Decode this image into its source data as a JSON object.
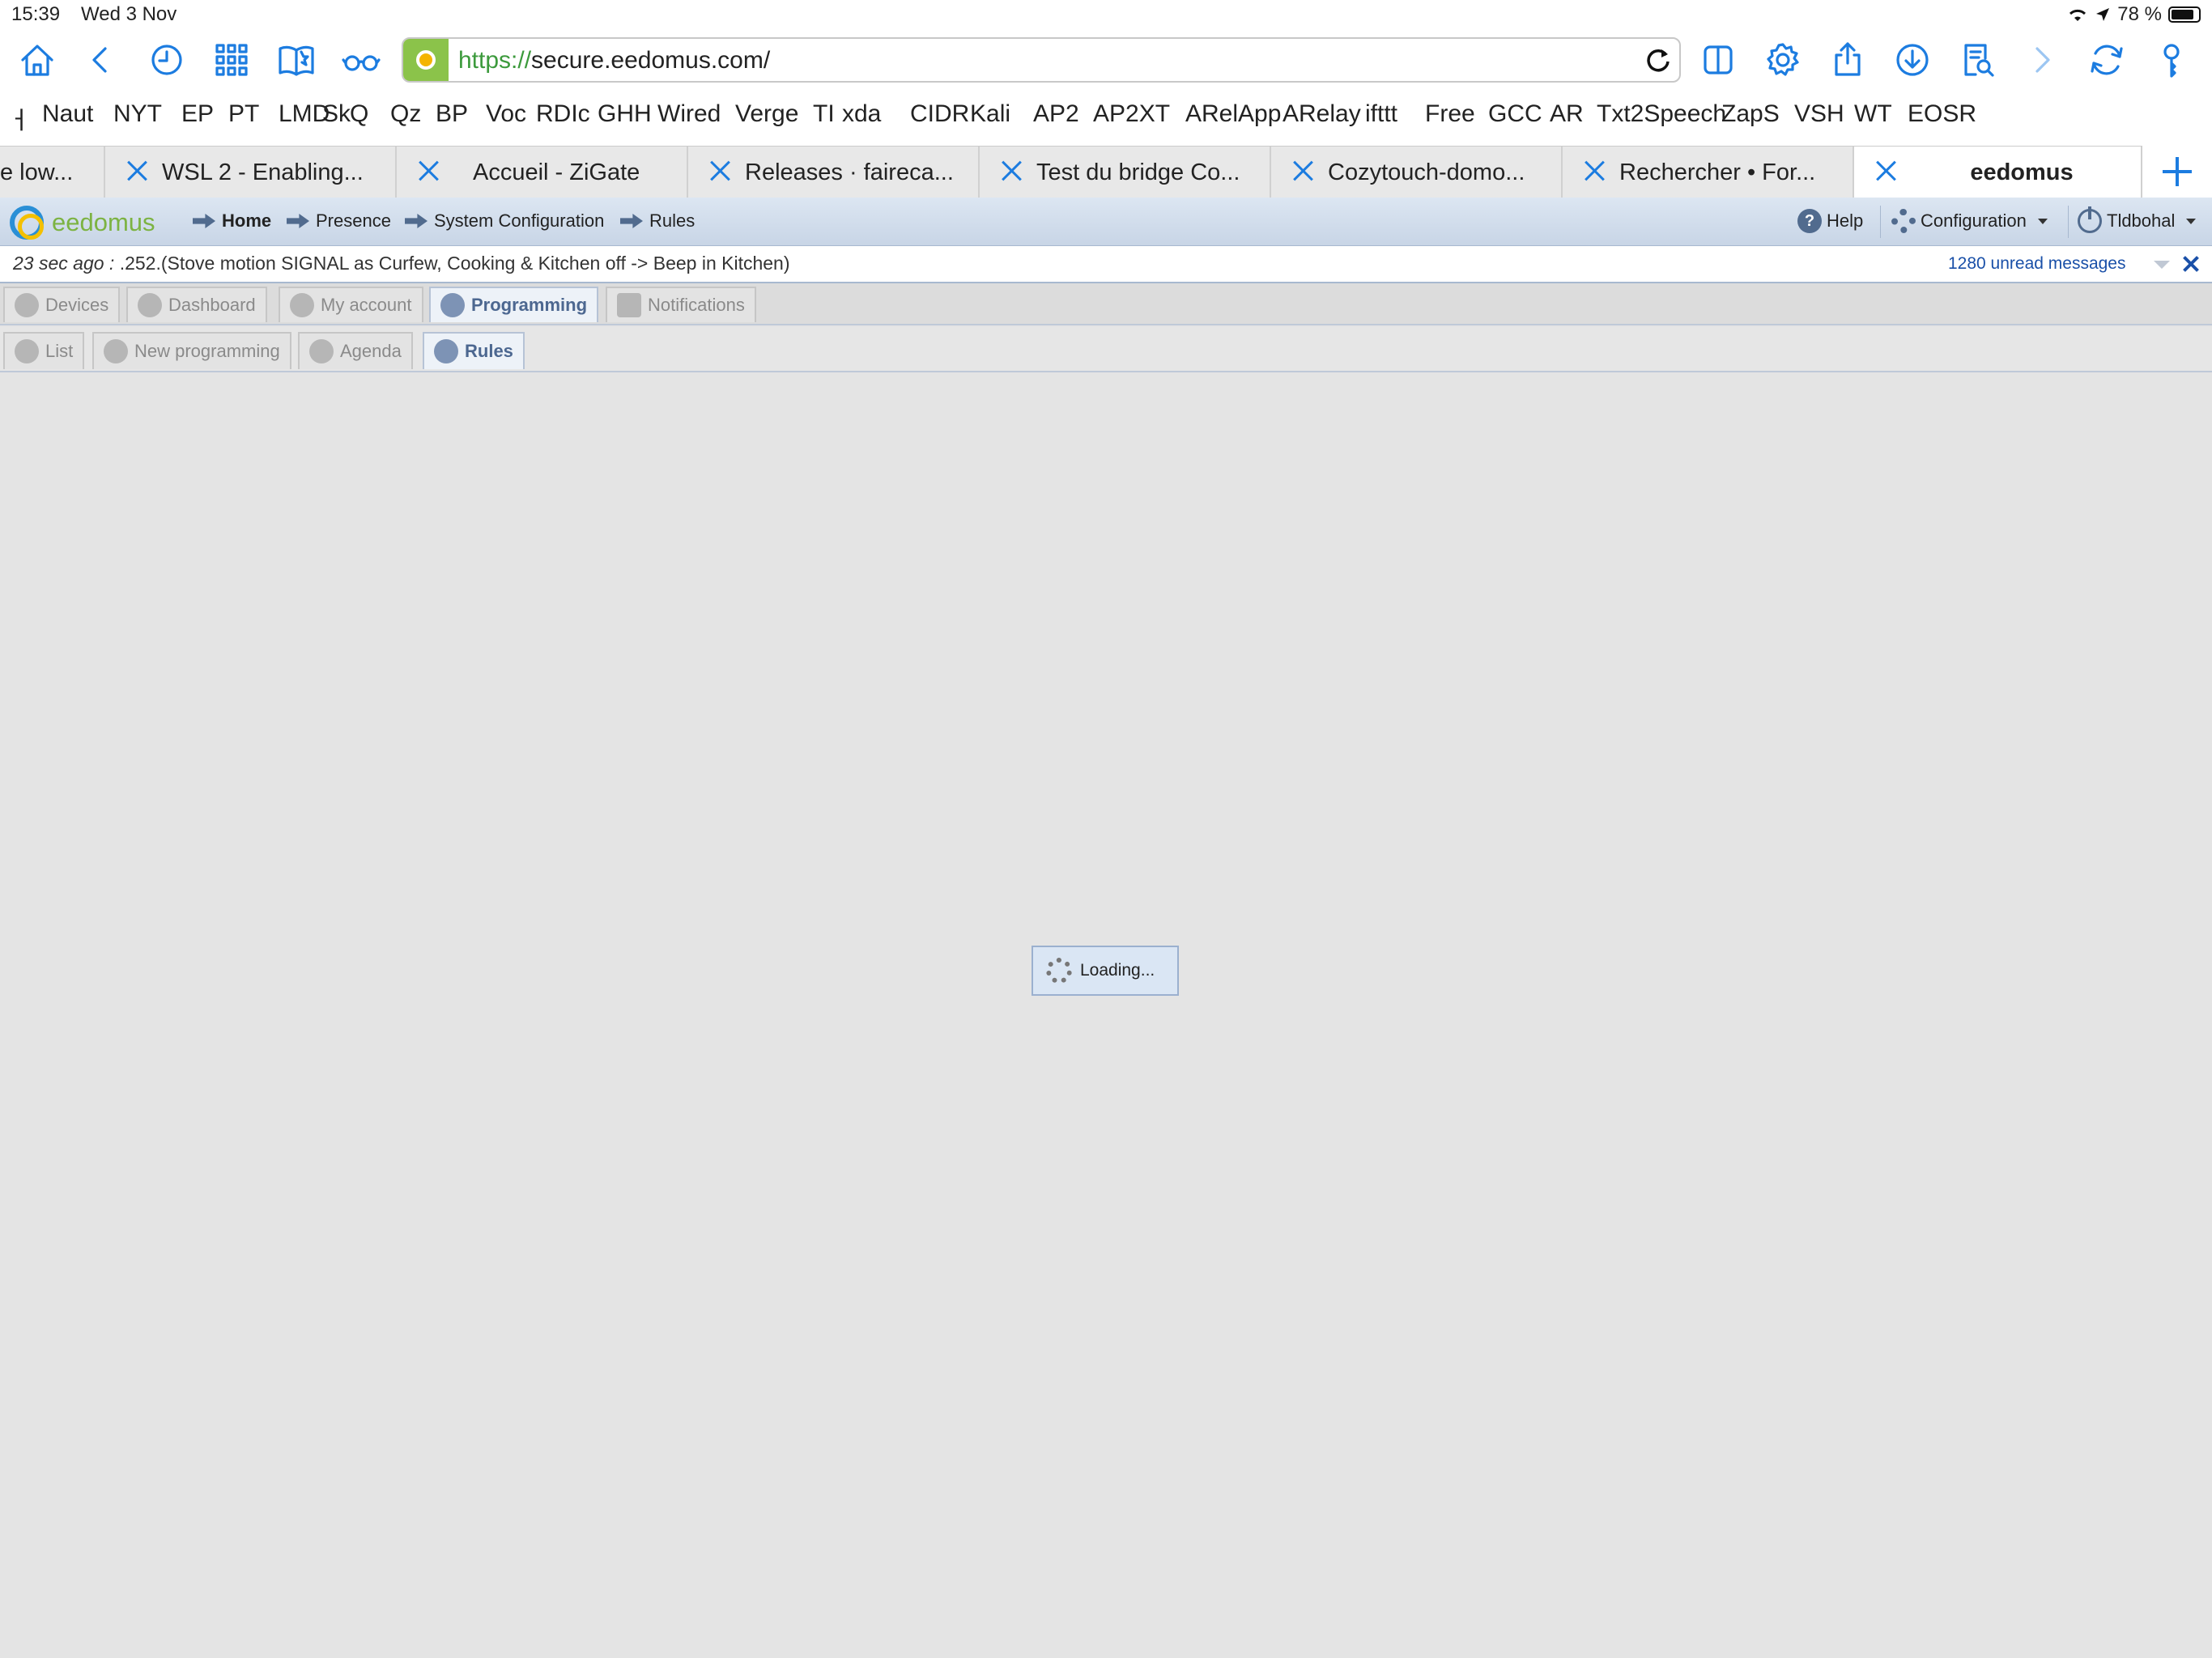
{
  "status_bar": {
    "time": "15:39",
    "date": "Wed 3 Nov",
    "battery": "78 %"
  },
  "toolbar": {
    "url_scheme": "https://",
    "url_rest": "secure.eedomus.com/",
    "icons": [
      "home-icon",
      "back-icon",
      "history-icon",
      "grid-icon",
      "bookmarks-icon",
      "reader-glasses-icon",
      "sidebar-icon",
      "settings-icon",
      "share-icon",
      "download-icon",
      "find-icon",
      "forward-icon",
      "sync-icon",
      "key-icon"
    ]
  },
  "bookmarks": [
    "Naut",
    "NYT",
    "EP",
    "PT",
    "LMD",
    "Sk",
    "Q",
    "Qz",
    "BP",
    "Voc",
    "RDIc",
    "GHH",
    "Wired",
    "Verge",
    "TI",
    "xda",
    "CIDR",
    "Kali",
    "AP2",
    "AP2XT",
    "ARelApp",
    "ARelay",
    "ifttt",
    "Free",
    "GCC",
    "AR",
    "Txt2Speech",
    "ZapS",
    "VSH",
    "WT",
    "EOSR"
  ],
  "browser_tabs": [
    {
      "title": "e low..."
    },
    {
      "title": "WSL 2 - Enabling..."
    },
    {
      "title": "Accueil - ZiGate"
    },
    {
      "title": "Releases · faireca..."
    },
    {
      "title": "Test du bridge Co..."
    },
    {
      "title": "Cozytouch-domo..."
    },
    {
      "title": "Rechercher • For..."
    },
    {
      "title": "eedomus"
    }
  ],
  "app": {
    "logo": "eedomus",
    "nav": [
      "Home",
      "Presence",
      "System Configuration",
      "Rules"
    ],
    "help": "Help",
    "configuration": "Configuration",
    "user": "Tldbohal",
    "message_time": "23 sec ago :",
    "message_text": " .252.(Stove motion SIGNAL as Curfew, Cooking & Kitchen off -> Beep in Kitchen)",
    "unread": "1280 unread messages",
    "main_tabs": [
      "Devices",
      "Dashboard",
      "My account",
      "Programming",
      "Notifications"
    ],
    "sub_tabs": [
      "List",
      "New programming",
      "Agenda",
      "Rules"
    ],
    "loading": "Loading..."
  },
  "colors": {
    "accent": "#1c7ce0",
    "header": "#c8d5e6",
    "selected_tab": "#4c6790"
  }
}
